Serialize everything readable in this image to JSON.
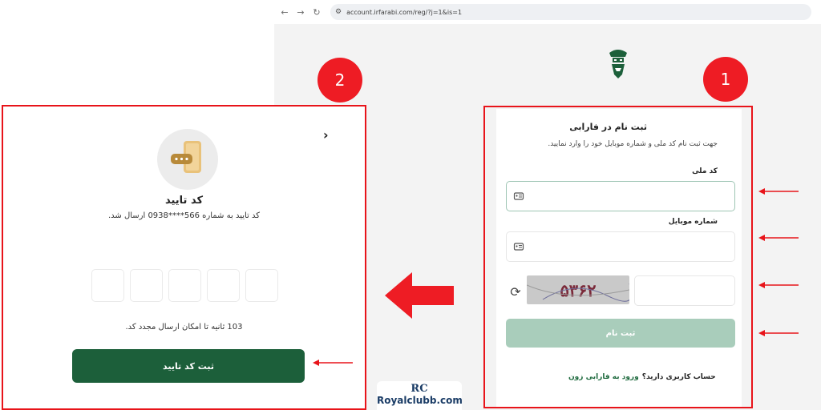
{
  "browser": {
    "back_icon": "←",
    "forward_icon": "→",
    "reload_icon": "↻",
    "url": "account.irfarabi.com/reg/?j=1&is=1"
  },
  "badges": {
    "one": "1",
    "two": "2"
  },
  "register": {
    "title": "ثبت نام در فارابی",
    "subtitle": "جهت ثبت نام کد ملی و شماره موبایل خود را وارد نمایید.",
    "national_id_label": "کد ملی",
    "national_id_value": "",
    "mobile_label": "شماره موبایل",
    "mobile_value": "",
    "captcha_text": "۵۳۶۲",
    "captcha_value": "",
    "submit_label": "ثبت نام",
    "account_question": "حساب کاربری دارید؟",
    "login_link": "ورود به فارابی زون"
  },
  "verify": {
    "title": "کد تایید",
    "subtitle": "کد تایید به شماره 566****0938 ارسال شد.",
    "otp_digits": [
      "",
      "",
      "",
      "",
      ""
    ],
    "timer_text": "103 ثانیه تا امکان ارسال مجدد کد.",
    "submit_label": "ثبت کد تایید"
  },
  "watermark": {
    "mark": "RC",
    "text": "Royalclubb.com"
  },
  "colors": {
    "brand_green": "#1c5f3a",
    "disabled_green": "#a9cdbb",
    "annotation_red": "#e8141a"
  }
}
